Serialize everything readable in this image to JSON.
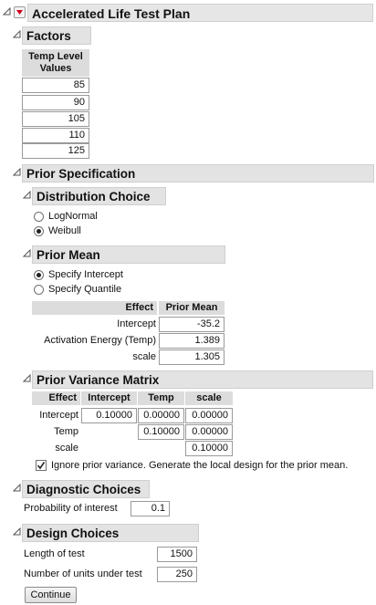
{
  "title": "Accelerated Life Test Plan",
  "factors": {
    "heading": "Factors",
    "col_header_line1": "Temp Level",
    "col_header_line2": "Values",
    "values": [
      "85",
      "90",
      "105",
      "110",
      "125"
    ]
  },
  "prior_spec": {
    "heading": "Prior Specification",
    "distribution": {
      "heading": "Distribution Choice",
      "options": [
        "LogNormal",
        "Weibull"
      ],
      "selected": "Weibull"
    },
    "prior_mean": {
      "heading": "Prior Mean",
      "options": [
        "Specify Intercept",
        "Specify Quantile"
      ],
      "selected": "Specify Intercept",
      "table": {
        "col_effect": "Effect",
        "col_mean": "Prior Mean",
        "rows": [
          {
            "effect": "Intercept",
            "value": "-35.2"
          },
          {
            "effect": "Activation Energy (Temp)",
            "value": "1.389"
          },
          {
            "effect": "scale",
            "value": "1.305"
          }
        ]
      }
    },
    "variance": {
      "heading": "Prior Variance Matrix",
      "headers": [
        "Effect",
        "Intercept",
        "Temp",
        "scale"
      ],
      "rows": [
        {
          "effect": "Intercept",
          "cells": [
            "0.10000",
            "0.00000",
            "0.00000"
          ]
        },
        {
          "effect": "Temp",
          "cells": [
            "",
            "0.10000",
            "0.00000"
          ]
        },
        {
          "effect": "scale",
          "cells": [
            "",
            "",
            "0.10000"
          ]
        }
      ],
      "ignore_label": "Ignore prior variance. Generate the local design for the prior mean.",
      "ignore_checked": true
    }
  },
  "diagnostic": {
    "heading": "Diagnostic Choices",
    "prob_label": "Probability of interest",
    "prob_value": "0.1"
  },
  "design": {
    "heading": "Design Choices",
    "length_label": "Length of test",
    "length_value": "1500",
    "units_label": "Number of units under test",
    "units_value": "250"
  },
  "continue_label": "Continue"
}
